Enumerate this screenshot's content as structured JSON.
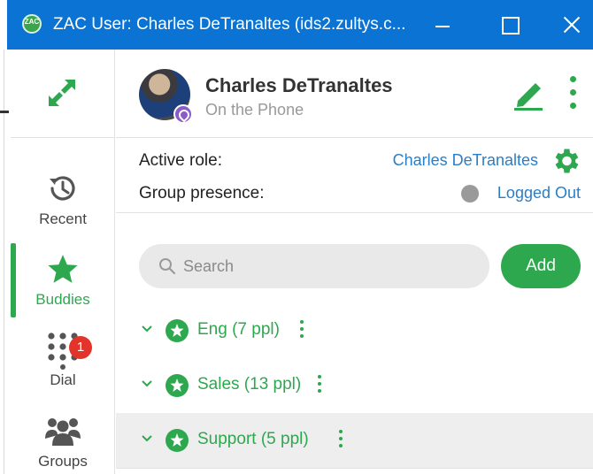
{
  "window": {
    "title": "ZAC User: Charles DeTranaltes (ids2.zultys.c...",
    "app_icon_text": "ZAC",
    "accent": "#0a73d3"
  },
  "sidebar": {
    "expand_icon": "expand-arrows-icon",
    "items": [
      {
        "label": "Recent",
        "icon": "history-icon",
        "active": false
      },
      {
        "label": "Buddies",
        "icon": "star-icon",
        "active": true
      },
      {
        "label": "Dial",
        "icon": "dialpad-icon",
        "active": false,
        "badge": "1"
      },
      {
        "label": "Groups",
        "icon": "users-icon",
        "active": false
      }
    ]
  },
  "profile": {
    "name": "Charles DeTranaltes",
    "status": "On the Phone",
    "presence_color": "#8c5cc6"
  },
  "roles": {
    "active_role_label": "Active role:",
    "active_role_value": "Charles DeTranaltes",
    "group_presence_label": "Group presence:",
    "group_presence_value": "Logged Out"
  },
  "search": {
    "placeholder": "Search",
    "value": ""
  },
  "add_label": "Add",
  "groups": [
    {
      "label": "Eng (7 ppl)",
      "highlighted": false
    },
    {
      "label": "Sales (13 ppl)",
      "highlighted": false
    },
    {
      "label": "Support (5 ppl)",
      "highlighted": true
    }
  ],
  "brand_green": "#2ea84f"
}
